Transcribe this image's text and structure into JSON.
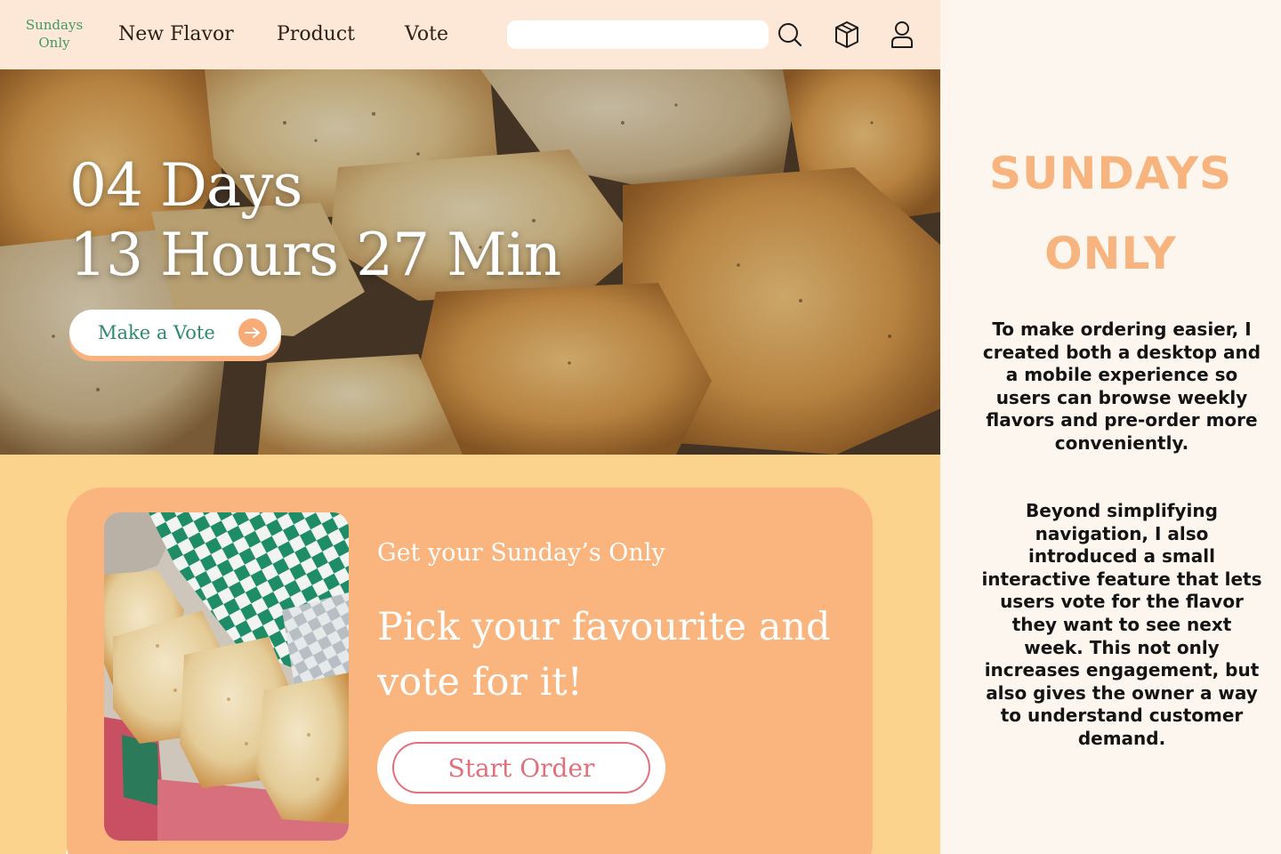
{
  "nav": {
    "logo_line1": "Sundays",
    "logo_line2": "Only",
    "links": [
      "New Flavor",
      "Product",
      "Vote"
    ],
    "search": {
      "value": "",
      "placeholder": ""
    },
    "icons": [
      "search-icon",
      "box-icon",
      "user-icon"
    ]
  },
  "hero": {
    "countdown_line1": "04 Days",
    "countdown_line2": "13 Hours 27 Min",
    "vote_button": "Make a Vote"
  },
  "card": {
    "subtitle": "Get your Sunday’s Only",
    "title": "Pick your favourite and vote for it!",
    "start_button": "Start Order"
  },
  "panel": {
    "title_line1": "SUNDAYS",
    "title_line2": "ONLY",
    "paragraph1": "To make ordering easier, I created both a desktop and a mobile experience so users can browse weekly flavors and pre-order more conveniently.",
    "paragraph2": "Beyond simplifying navigation, I also introduced a small interactive feature that lets users vote for the flavor they want to see next week. This not only increases engagement, but also gives the owner a way to understand customer demand."
  },
  "colors": {
    "nav_bg": "#fde8d8",
    "section_bg": "#fcd38c",
    "card_bg": "#fab47e",
    "accent_green": "#2f8a6a",
    "accent_pink": "#e0707c",
    "panel_title": "#f7b47e"
  }
}
